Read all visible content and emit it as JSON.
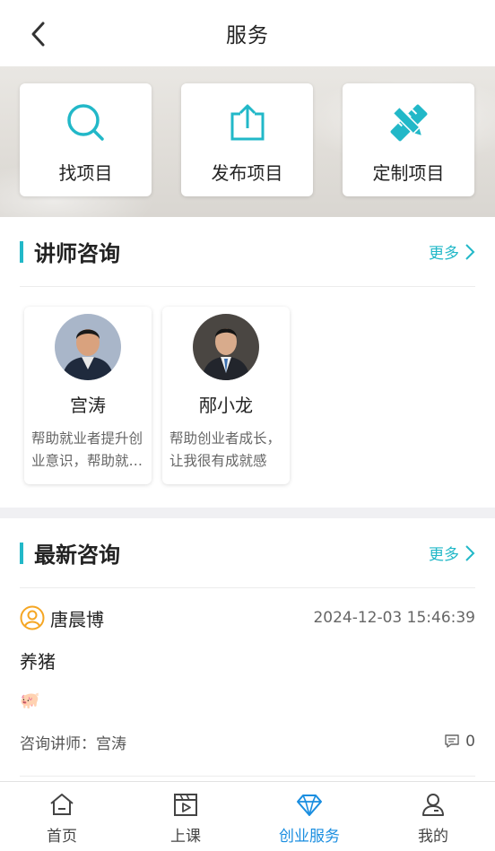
{
  "header": {
    "title": "服务"
  },
  "quick_actions": [
    {
      "label": "找项目",
      "icon": "search-icon"
    },
    {
      "label": "发布项目",
      "icon": "upload-icon"
    },
    {
      "label": "定制项目",
      "icon": "pencil-ruler-icon"
    }
  ],
  "teachers_section": {
    "title": "讲师咨询",
    "more": "更多",
    "teachers": [
      {
        "name": "宫涛",
        "desc": "帮助就业者提升创业意识，帮助就业者提升创业能力"
      },
      {
        "name": "邴小龙",
        "desc": "帮助创业者成长，让我很有成就感"
      }
    ]
  },
  "consult_section": {
    "title": "最新咨询",
    "more": "更多",
    "items": [
      {
        "user": "唐晨博",
        "time": "2024-12-03 15:46:39",
        "question": "养猪",
        "emoji": "🐖",
        "teacher": "咨询讲师：宫涛",
        "count": "0"
      }
    ]
  },
  "tabbar": [
    {
      "label": "首页",
      "icon": "home-icon"
    },
    {
      "label": "上课",
      "icon": "video-icon"
    },
    {
      "label": "创业服务",
      "icon": "diamond-icon",
      "active": true
    },
    {
      "label": "我的",
      "icon": "profile-icon"
    }
  ],
  "colors": {
    "accent": "#22b8c8",
    "tab_active": "#1a8ee0",
    "user_icon": "#f5a623"
  }
}
